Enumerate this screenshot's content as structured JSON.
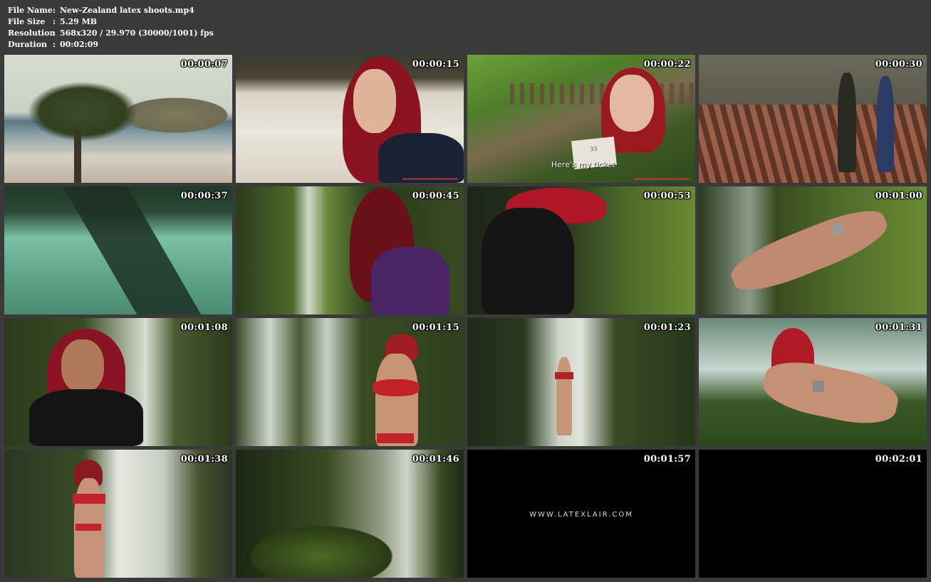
{
  "info": {
    "rows": [
      {
        "label": "File Name",
        "value": "New-Zealand latex shoots.mp4"
      },
      {
        "label": "File Size",
        "value": "5.29 MB"
      },
      {
        "label": "Resolution",
        "value": "568x320 / 29.970 (30000/1001) fps"
      },
      {
        "label": "Duration",
        "value": "00:02:09"
      }
    ],
    "separator": ":"
  },
  "thumbnails": [
    {
      "timecode": "00:00:07"
    },
    {
      "timecode": "00:00:15"
    },
    {
      "timecode": "00:00:22",
      "caption": "Here's my ticket",
      "ticket_number": "33"
    },
    {
      "timecode": "00:00:30"
    },
    {
      "timecode": "00:00:37"
    },
    {
      "timecode": "00:00:45"
    },
    {
      "timecode": "00:00:53"
    },
    {
      "timecode": "00:01:00"
    },
    {
      "timecode": "00:01:08"
    },
    {
      "timecode": "00:01:15"
    },
    {
      "timecode": "00:01:23"
    },
    {
      "timecode": "00:01:31"
    },
    {
      "timecode": "00:01:38"
    },
    {
      "timecode": "00:01:46"
    },
    {
      "timecode": "00:01:57",
      "watermark": "WWW.LATEXLAIR.COM"
    },
    {
      "timecode": "00:02:01"
    }
  ],
  "colors": {
    "background": "#3a3a3a",
    "text": "#ffffff",
    "hair": "#a01020"
  }
}
